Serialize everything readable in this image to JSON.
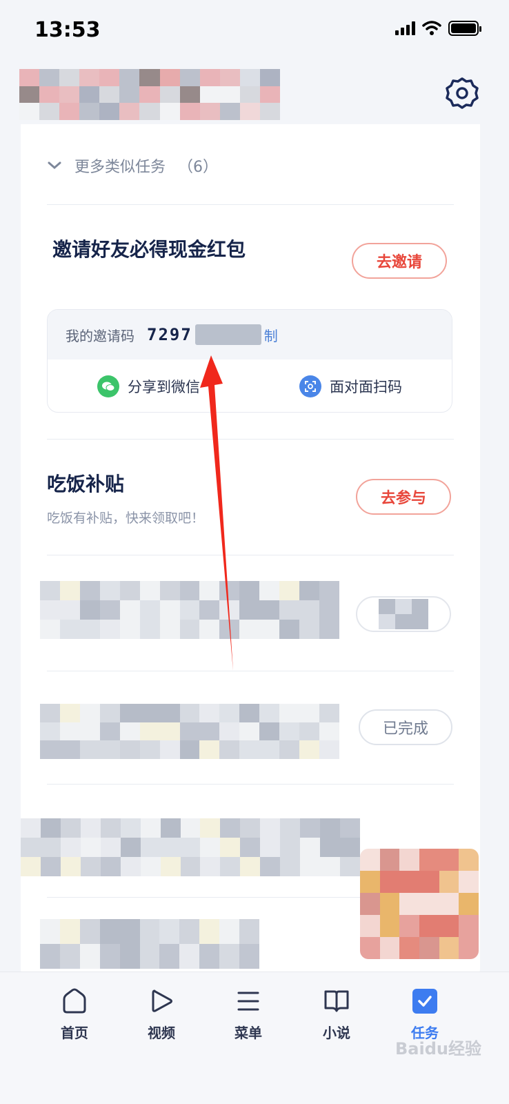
{
  "status_bar": {
    "time": "13:53"
  },
  "section_more": {
    "label": "更多类似任务",
    "count": "（6）"
  },
  "invite_task": {
    "title": "邀请好友必得现金红包",
    "button": "去邀请",
    "code_label": "我的邀请码",
    "code_visible": "7297",
    "copy_label": "制",
    "share_wechat": "分享到微信",
    "face_scan": "面对面扫码"
  },
  "meal_task": {
    "title": "吃饭补贴",
    "subtitle": "吃饭有补贴，快来领取吧！",
    "button": "去参与"
  },
  "blurred_task_2": {
    "button": "已完成"
  },
  "tabbar": {
    "items": [
      {
        "label": "首页",
        "icon": "home-icon"
      },
      {
        "label": "视频",
        "icon": "play-icon"
      },
      {
        "label": "菜单",
        "icon": "menu-icon"
      },
      {
        "label": "小说",
        "icon": "book-icon"
      },
      {
        "label": "任务",
        "icon": "task-check-icon",
        "active": true
      }
    ]
  },
  "colors": {
    "accent_red": "#e8473b",
    "accent_blue": "#3d7cf0",
    "wechat_green": "#3cc46a"
  },
  "watermark": "Baidu经验"
}
